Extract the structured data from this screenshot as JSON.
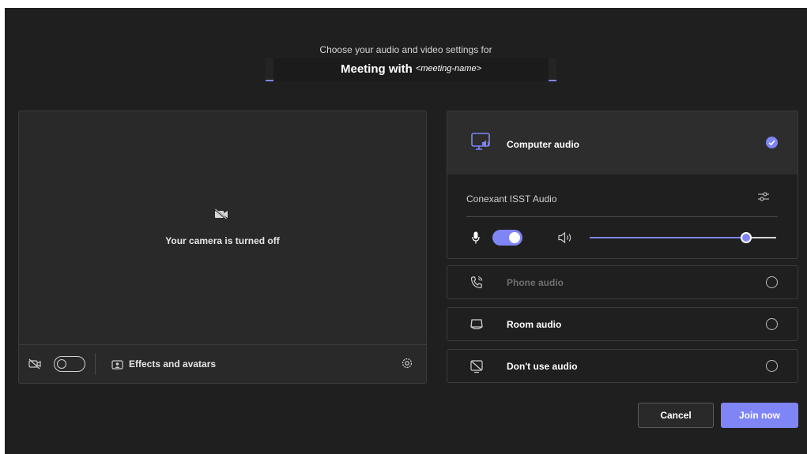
{
  "header": {
    "prompt": "Choose your audio and video settings for",
    "title_prefix": "Meeting with",
    "meeting_name": "<meeting-name>"
  },
  "video": {
    "camera_status": "Your camera is turned off",
    "camera_enabled": false,
    "effects_label": "Effects and avatars",
    "icons": [
      "camera-off-icon",
      "video-off-icon",
      "effects-icon",
      "device-settings-icon"
    ]
  },
  "audio": {
    "options": [
      {
        "label": "Computer audio",
        "selected": true,
        "enabled": true,
        "icon": "computer-audio-icon"
      },
      {
        "label": "Phone audio",
        "selected": false,
        "enabled": false,
        "icon": "phone-audio-icon"
      },
      {
        "label": "Room audio",
        "selected": false,
        "enabled": true,
        "icon": "room-audio-icon"
      },
      {
        "label": "Don't use audio",
        "selected": false,
        "enabled": true,
        "icon": "no-audio-icon"
      }
    ],
    "device_name": "Conexant ISST Audio",
    "mic_enabled": true,
    "volume_percent": 84
  },
  "actions": {
    "cancel_label": "Cancel",
    "join_label": "Join now"
  },
  "colors": {
    "accent": "#7f85f5",
    "background": "#1f1f1f",
    "panel": "#292929",
    "selected_option_bg": "#2d2d2d"
  }
}
